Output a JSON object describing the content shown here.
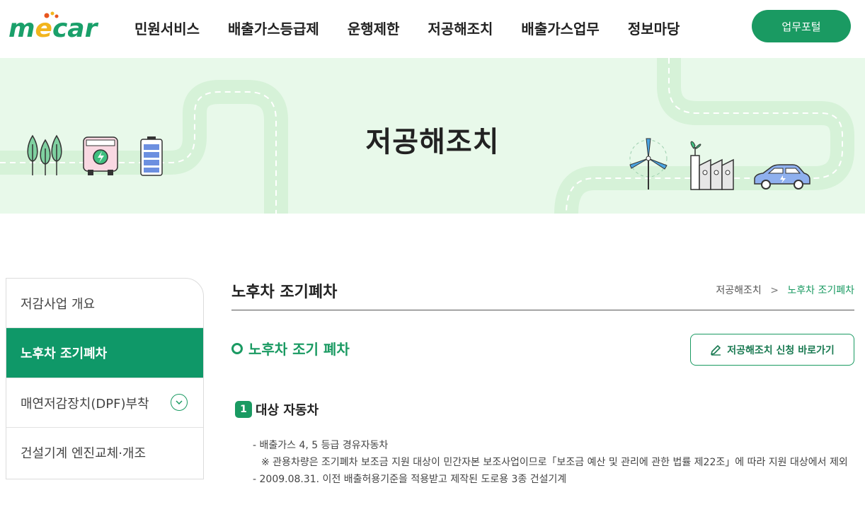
{
  "header": {
    "logo_text": "mecar",
    "nav": [
      "민원서비스",
      "배출가스등급제",
      "운행제한",
      "저공해조치",
      "배출가스업무",
      "정보마당"
    ],
    "portal_button": "업무포털"
  },
  "banner": {
    "title": "저공해조치"
  },
  "sidebar": {
    "items": [
      {
        "label": "저감사업 개요"
      },
      {
        "label": "노후차 조기폐차"
      },
      {
        "label": "매연저감장치(DPF)부착"
      },
      {
        "label": "건설기계 엔진교체·개조"
      }
    ]
  },
  "main": {
    "page_title": "노후차 조기폐차",
    "breadcrumb": {
      "parent": "저공해조치",
      "separator": ">",
      "current": "노후차 조기폐차"
    },
    "section_title": "노후차 조기 폐차",
    "apply_button": "저공해조치 신청 바로가기",
    "subsection": {
      "number": "1",
      "title": "대상 자동차",
      "lines": [
        "- 배출가스 4, 5 등급 경유자동차",
        "※ 관용차량은 조기폐차 보조금 지원 대상이 민간자본 보조사업이므로「보조금 예산 및 관리에 관한 법률 제22조」에 따라 지원 대상에서 제외",
        "- 2009.08.31. 이전 배출허용기준을 적용받고 제작된 도로용 3종 건설기계"
      ]
    }
  },
  "colors": {
    "brand_green": "#1a9a62",
    "banner_bg": "#e8f9ea",
    "road": "#d6f2d8"
  }
}
